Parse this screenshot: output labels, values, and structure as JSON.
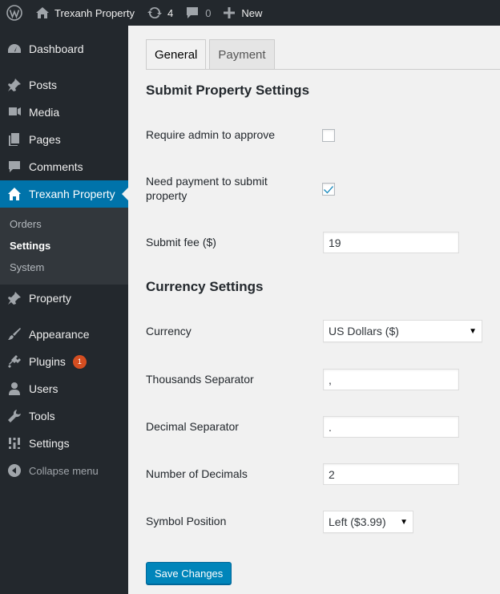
{
  "adminbar": {
    "site_name": "Trexanh Property",
    "updates_count": "4",
    "comments_count": "0",
    "new_label": "New"
  },
  "sidebar": {
    "items": [
      {
        "label": "Dashboard",
        "icon": "dashboard-icon"
      },
      {
        "label": "Posts",
        "icon": "pin-icon"
      },
      {
        "label": "Media",
        "icon": "media-icon"
      },
      {
        "label": "Pages",
        "icon": "pages-icon"
      },
      {
        "label": "Comments",
        "icon": "comment-icon"
      },
      {
        "label": "Trexanh Property",
        "icon": "home-icon"
      },
      {
        "label": "Property",
        "icon": "pin-icon"
      },
      {
        "label": "Appearance",
        "icon": "brush-icon"
      },
      {
        "label": "Plugins",
        "icon": "plugin-icon",
        "badge": "1"
      },
      {
        "label": "Users",
        "icon": "user-icon"
      },
      {
        "label": "Tools",
        "icon": "wrench-icon"
      },
      {
        "label": "Settings",
        "icon": "sliders-icon"
      }
    ],
    "submenu": [
      "Orders",
      "Settings",
      "System"
    ],
    "collapse_label": "Collapse menu"
  },
  "tabs": [
    "General",
    "Payment"
  ],
  "sections": {
    "submit": "Submit Property Settings",
    "currency": "Currency Settings"
  },
  "fields": {
    "require_admin": {
      "label": "Require admin to approve",
      "checked": false
    },
    "need_payment": {
      "label": "Need payment to submit property",
      "checked": true
    },
    "submit_fee": {
      "label": "Submit fee ($)",
      "value": "19"
    },
    "currency": {
      "label": "Currency",
      "value": "US Dollars ($)"
    },
    "thousands_sep": {
      "label": "Thousands Separator",
      "value": ","
    },
    "decimal_sep": {
      "label": "Decimal Separator",
      "value": "."
    },
    "num_decimals": {
      "label": "Number of Decimals",
      "value": "2"
    },
    "symbol_position": {
      "label": "Symbol Position",
      "value": "Left ($3.99)"
    }
  },
  "save_label": "Save Changes",
  "colors": {
    "accent": "#0073aa",
    "sidebar": "#23282d",
    "button": "#0085ba"
  }
}
